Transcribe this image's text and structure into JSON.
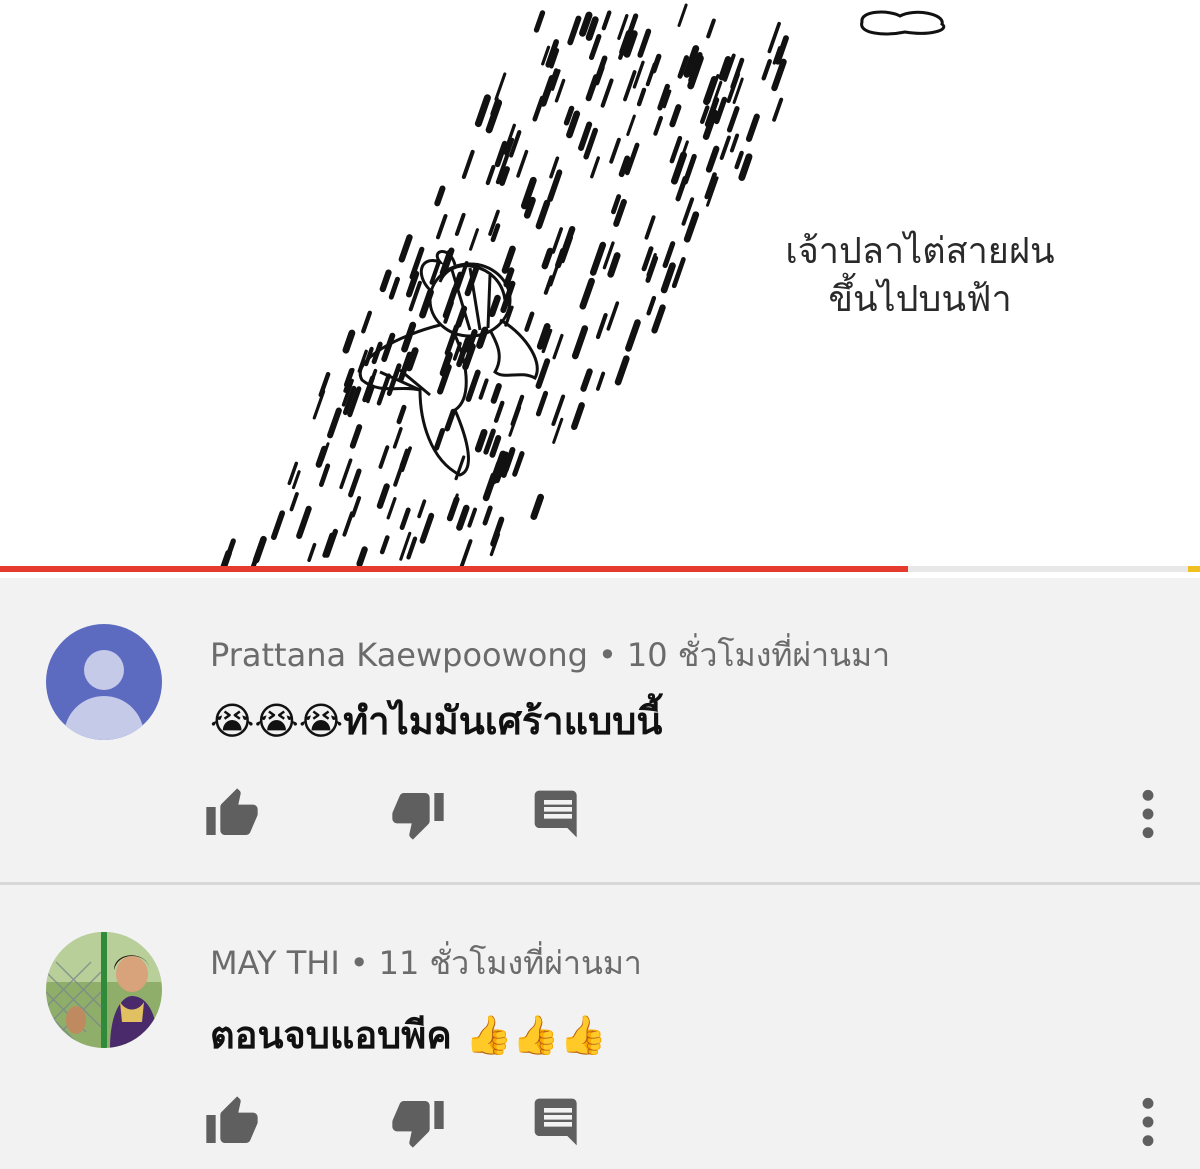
{
  "video": {
    "caption_line1": "เจ้าปลาไต่สายฝน",
    "caption_line2": "ขึ้นไปบนฟ้า",
    "progress_fraction": 0.757
  },
  "comments": [
    {
      "author": "Prattana Kaewpoowong",
      "separator": "•",
      "time": "10 ชั่วโมงที่ผ่านมา",
      "text": "😭😭😭ทำไมมันเศร้าแบบนี้",
      "avatar": "default-avatar-icon"
    },
    {
      "author": "MAY THI",
      "separator": "•",
      "time": "11 ชั่วโมงที่ผ่านมา",
      "text": "ตอนจบแอบพีค 👍👍👍",
      "avatar": "photo-avatar"
    }
  ],
  "colors": {
    "progress": "#e53a2e",
    "avatar_default_bg": "#5c6bc0",
    "background": "#f2f2f2"
  },
  "icons": [
    "thumbs-up-icon",
    "thumbs-down-icon",
    "reply-icon",
    "more-vert-icon"
  ]
}
